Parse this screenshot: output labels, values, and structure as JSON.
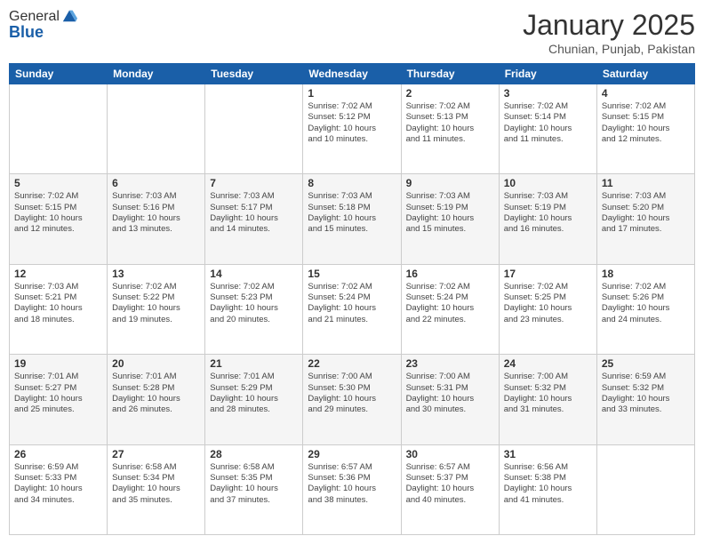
{
  "logo": {
    "general": "General",
    "blue": "Blue"
  },
  "header": {
    "title": "January 2025",
    "subtitle": "Chunian, Punjab, Pakistan"
  },
  "weekdays": [
    "Sunday",
    "Monday",
    "Tuesday",
    "Wednesday",
    "Thursday",
    "Friday",
    "Saturday"
  ],
  "weeks": [
    [
      {
        "day": "",
        "info": ""
      },
      {
        "day": "",
        "info": ""
      },
      {
        "day": "",
        "info": ""
      },
      {
        "day": "1",
        "info": "Sunrise: 7:02 AM\nSunset: 5:12 PM\nDaylight: 10 hours\nand 10 minutes."
      },
      {
        "day": "2",
        "info": "Sunrise: 7:02 AM\nSunset: 5:13 PM\nDaylight: 10 hours\nand 11 minutes."
      },
      {
        "day": "3",
        "info": "Sunrise: 7:02 AM\nSunset: 5:14 PM\nDaylight: 10 hours\nand 11 minutes."
      },
      {
        "day": "4",
        "info": "Sunrise: 7:02 AM\nSunset: 5:15 PM\nDaylight: 10 hours\nand 12 minutes."
      }
    ],
    [
      {
        "day": "5",
        "info": "Sunrise: 7:02 AM\nSunset: 5:15 PM\nDaylight: 10 hours\nand 12 minutes."
      },
      {
        "day": "6",
        "info": "Sunrise: 7:03 AM\nSunset: 5:16 PM\nDaylight: 10 hours\nand 13 minutes."
      },
      {
        "day": "7",
        "info": "Sunrise: 7:03 AM\nSunset: 5:17 PM\nDaylight: 10 hours\nand 14 minutes."
      },
      {
        "day": "8",
        "info": "Sunrise: 7:03 AM\nSunset: 5:18 PM\nDaylight: 10 hours\nand 15 minutes."
      },
      {
        "day": "9",
        "info": "Sunrise: 7:03 AM\nSunset: 5:19 PM\nDaylight: 10 hours\nand 15 minutes."
      },
      {
        "day": "10",
        "info": "Sunrise: 7:03 AM\nSunset: 5:19 PM\nDaylight: 10 hours\nand 16 minutes."
      },
      {
        "day": "11",
        "info": "Sunrise: 7:03 AM\nSunset: 5:20 PM\nDaylight: 10 hours\nand 17 minutes."
      }
    ],
    [
      {
        "day": "12",
        "info": "Sunrise: 7:03 AM\nSunset: 5:21 PM\nDaylight: 10 hours\nand 18 minutes."
      },
      {
        "day": "13",
        "info": "Sunrise: 7:02 AM\nSunset: 5:22 PM\nDaylight: 10 hours\nand 19 minutes."
      },
      {
        "day": "14",
        "info": "Sunrise: 7:02 AM\nSunset: 5:23 PM\nDaylight: 10 hours\nand 20 minutes."
      },
      {
        "day": "15",
        "info": "Sunrise: 7:02 AM\nSunset: 5:24 PM\nDaylight: 10 hours\nand 21 minutes."
      },
      {
        "day": "16",
        "info": "Sunrise: 7:02 AM\nSunset: 5:24 PM\nDaylight: 10 hours\nand 22 minutes."
      },
      {
        "day": "17",
        "info": "Sunrise: 7:02 AM\nSunset: 5:25 PM\nDaylight: 10 hours\nand 23 minutes."
      },
      {
        "day": "18",
        "info": "Sunrise: 7:02 AM\nSunset: 5:26 PM\nDaylight: 10 hours\nand 24 minutes."
      }
    ],
    [
      {
        "day": "19",
        "info": "Sunrise: 7:01 AM\nSunset: 5:27 PM\nDaylight: 10 hours\nand 25 minutes."
      },
      {
        "day": "20",
        "info": "Sunrise: 7:01 AM\nSunset: 5:28 PM\nDaylight: 10 hours\nand 26 minutes."
      },
      {
        "day": "21",
        "info": "Sunrise: 7:01 AM\nSunset: 5:29 PM\nDaylight: 10 hours\nand 28 minutes."
      },
      {
        "day": "22",
        "info": "Sunrise: 7:00 AM\nSunset: 5:30 PM\nDaylight: 10 hours\nand 29 minutes."
      },
      {
        "day": "23",
        "info": "Sunrise: 7:00 AM\nSunset: 5:31 PM\nDaylight: 10 hours\nand 30 minutes."
      },
      {
        "day": "24",
        "info": "Sunrise: 7:00 AM\nSunset: 5:32 PM\nDaylight: 10 hours\nand 31 minutes."
      },
      {
        "day": "25",
        "info": "Sunrise: 6:59 AM\nSunset: 5:32 PM\nDaylight: 10 hours\nand 33 minutes."
      }
    ],
    [
      {
        "day": "26",
        "info": "Sunrise: 6:59 AM\nSunset: 5:33 PM\nDaylight: 10 hours\nand 34 minutes."
      },
      {
        "day": "27",
        "info": "Sunrise: 6:58 AM\nSunset: 5:34 PM\nDaylight: 10 hours\nand 35 minutes."
      },
      {
        "day": "28",
        "info": "Sunrise: 6:58 AM\nSunset: 5:35 PM\nDaylight: 10 hours\nand 37 minutes."
      },
      {
        "day": "29",
        "info": "Sunrise: 6:57 AM\nSunset: 5:36 PM\nDaylight: 10 hours\nand 38 minutes."
      },
      {
        "day": "30",
        "info": "Sunrise: 6:57 AM\nSunset: 5:37 PM\nDaylight: 10 hours\nand 40 minutes."
      },
      {
        "day": "31",
        "info": "Sunrise: 6:56 AM\nSunset: 5:38 PM\nDaylight: 10 hours\nand 41 minutes."
      },
      {
        "day": "",
        "info": ""
      }
    ]
  ]
}
